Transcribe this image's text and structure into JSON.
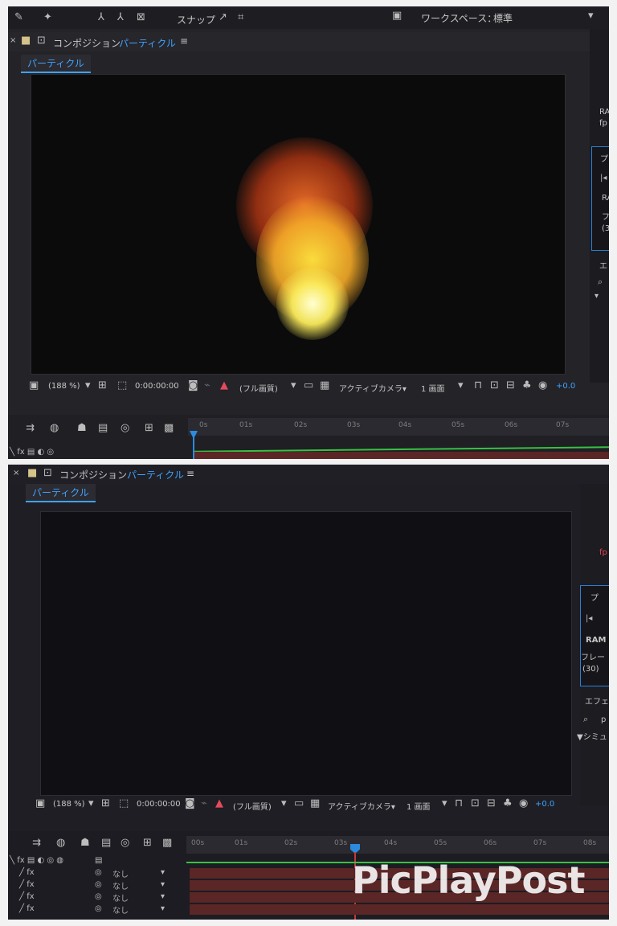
{
  "top": {
    "toolbar": {
      "snap_label": "スナップ",
      "workspace_label": "ワークスペース：",
      "workspace_value": "標準"
    },
    "comp_header": {
      "label": "コンポジション",
      "comp_name": "パーティクル",
      "menu_glyph": "≡"
    },
    "tab": "パーティクル",
    "viewer_bar": {
      "zoom": "(188 %)",
      "timecode": "0:00:00:00",
      "quality": "(フル画質)",
      "camera": "アクティブカメラ▾",
      "views": "1 画面",
      "exposure": "+0.0"
    },
    "ruler_ticks": [
      "0s",
      "01s",
      "02s",
      "03s",
      "04s",
      "05s",
      "06s",
      "07s"
    ],
    "right_panel": {
      "lines": [
        "RA",
        "fp",
        "プ",
        "RA",
        "フ",
        "(3",
        "エ"
      ]
    }
  },
  "bottom": {
    "comp_header": {
      "label": "コンポジション",
      "comp_name": "パーティクル",
      "menu_glyph": "≡"
    },
    "tab": "パーティクル",
    "viewer_bar": {
      "zoom": "(188 %)",
      "timecode": "0:00:00:00",
      "quality": "(フル画質)",
      "camera": "アクティブカメラ▾",
      "views": "1 画面",
      "exposure": "+0.0"
    },
    "ruler_ticks": [
      "00s",
      "01s",
      "02s",
      "03s",
      "04s",
      "05s",
      "06s",
      "07s",
      "08s"
    ],
    "layers": [
      {
        "parent": "なし"
      },
      {
        "parent": "なし"
      },
      {
        "parent": "なし"
      },
      {
        "parent": "なし"
      }
    ],
    "right_panel": {
      "lines": [
        "fp",
        "プ",
        "RAM",
        "フレー",
        "(30)",
        "エフェ",
        "p",
        "▼シミュ"
      ]
    }
  },
  "watermark": "PicPlayPost",
  "colors": {
    "accent": "#3fa3ff",
    "playhead": "#2c8bdf",
    "timeline_green": "#38c142",
    "track_red": "#5a2626"
  }
}
